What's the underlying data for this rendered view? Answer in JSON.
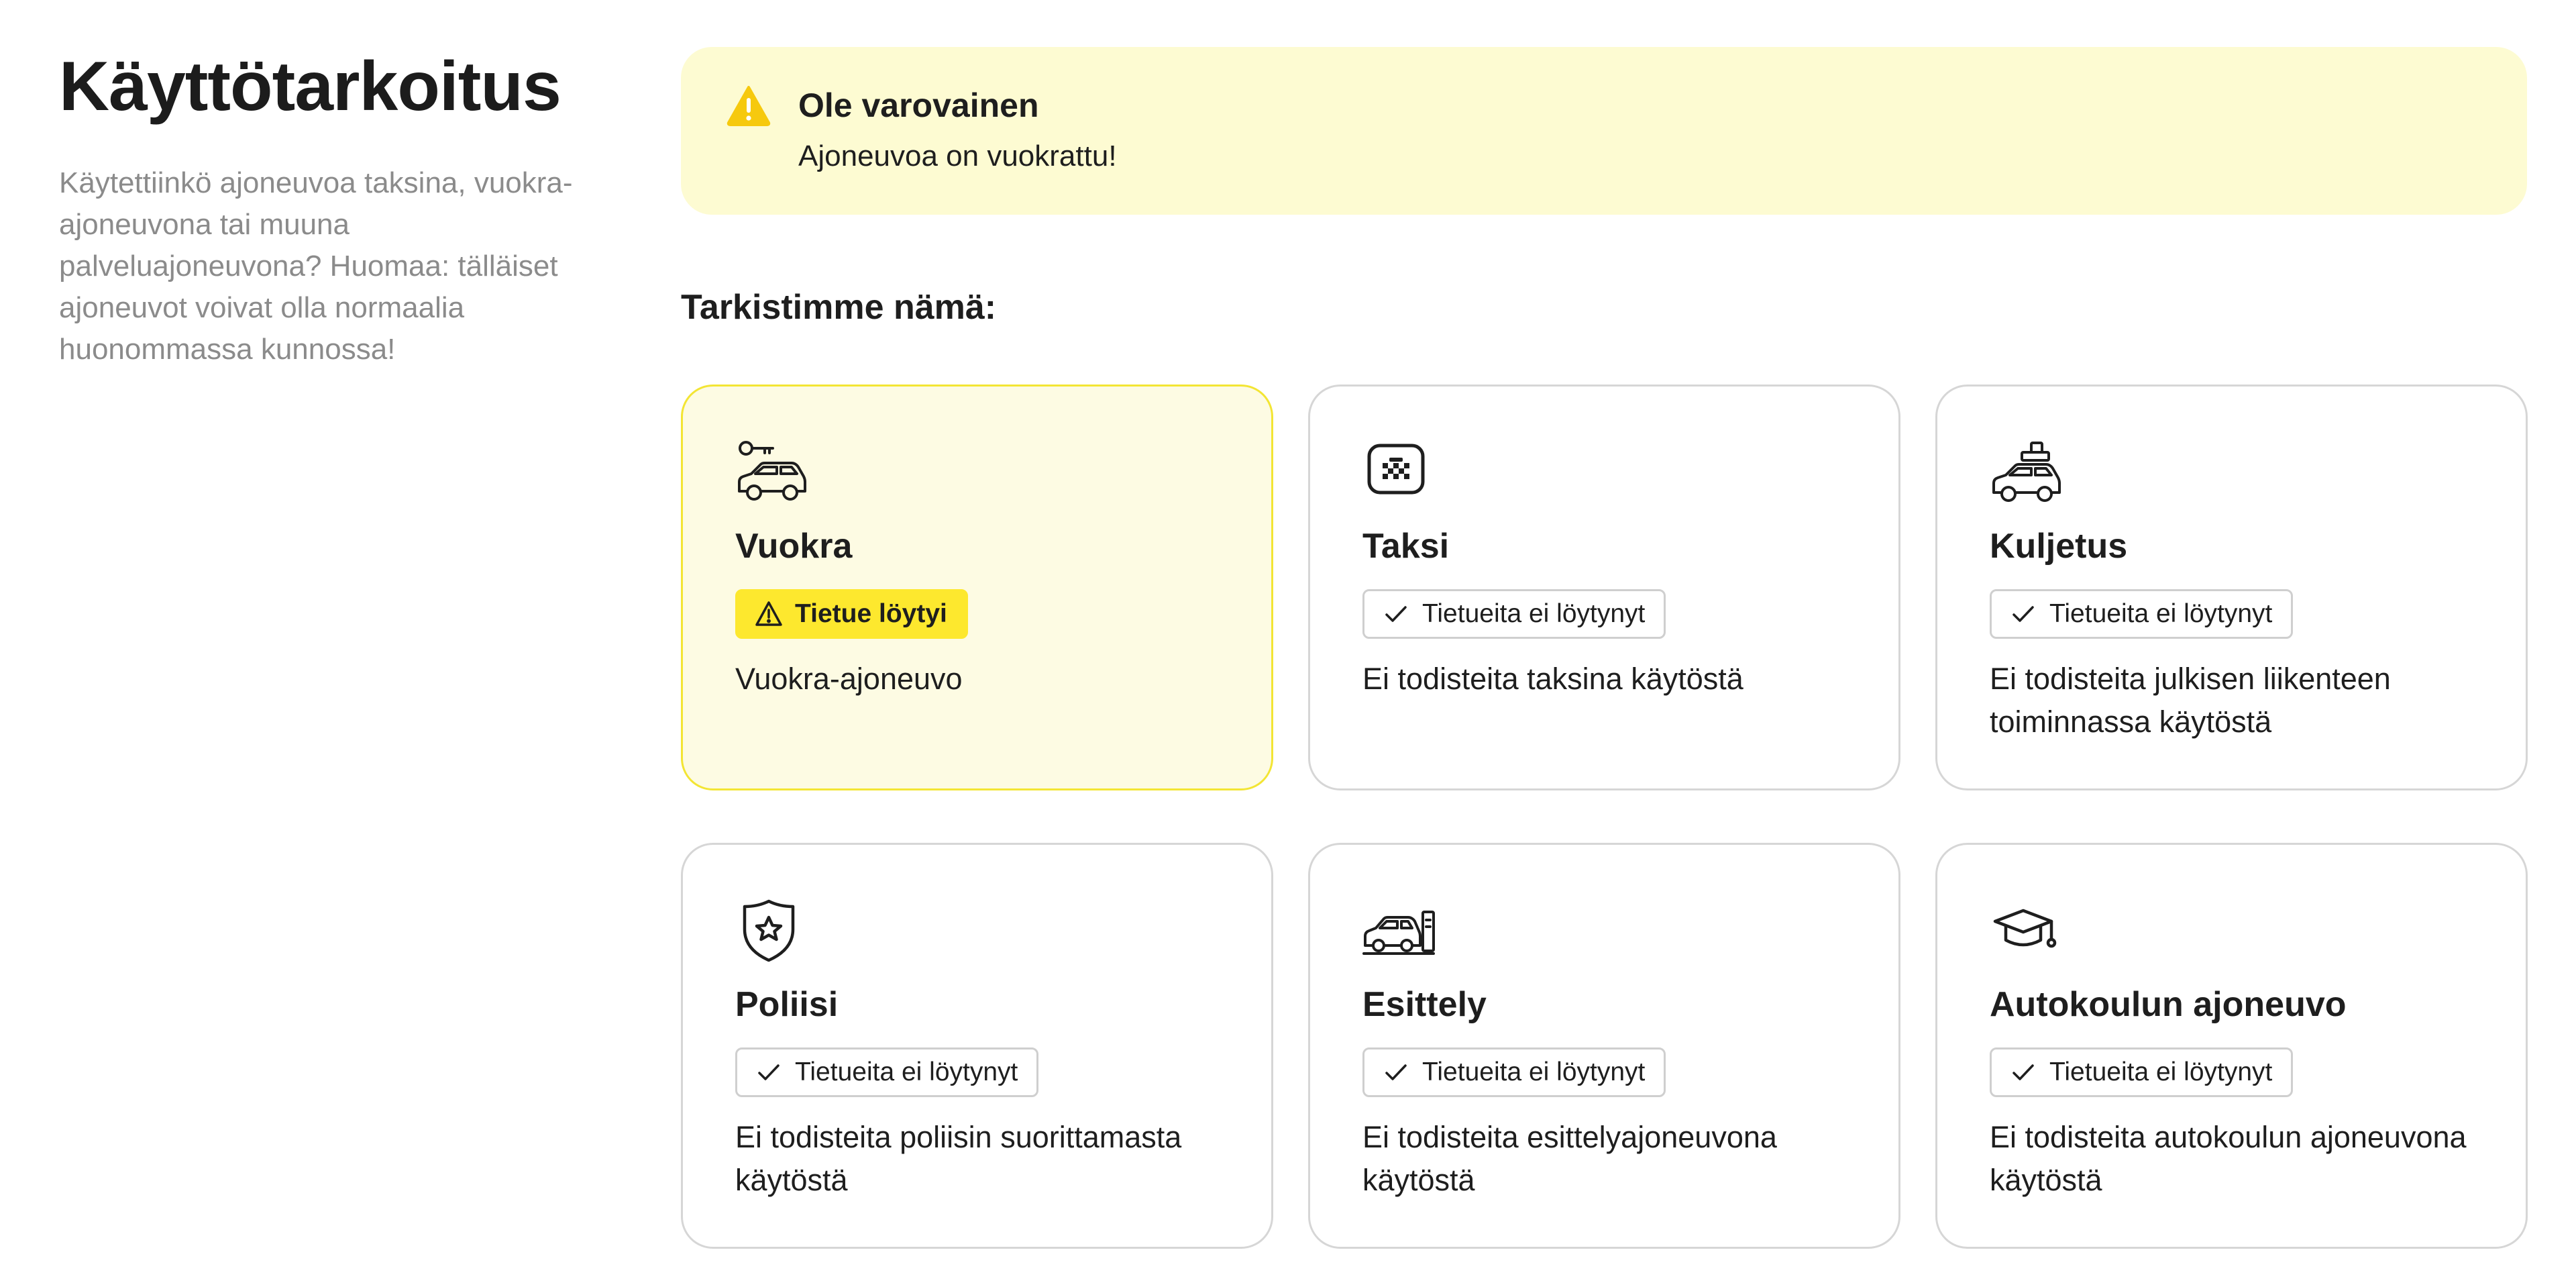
{
  "intro": {
    "title": "Käyttötarkoitus",
    "description": "Käytettiinkö ajoneuvoa taksina, vuokra-ajoneuvona tai muuna palveluajoneuvona? Huomaa: tälläiset ajoneuvot voivat olla normaalia huonommassa kunnossa!"
  },
  "banner": {
    "icon": "warning-triangle-icon",
    "title": "Ole varovainen",
    "text": "Ajoneuvoa on vuokrattu!",
    "background": "#fdfbd2"
  },
  "section_title": "Tarkistimme nämä:",
  "colors": {
    "accent_yellow": "#fde82e",
    "card_border": "#d6d6d6",
    "alert_border": "#f3e534"
  },
  "cards": [
    {
      "title": "Vuokra",
      "icon": "rental-car-key-icon",
      "status": "Tietue löytyi",
      "status_type": "found",
      "description": "Vuokra-ajoneuvo"
    },
    {
      "title": "Taksi",
      "icon": "taxi-sign-icon",
      "status": "Tietueita ei löytynyt",
      "status_type": "none",
      "description": "Ei todisteita taksina käytöstä"
    },
    {
      "title": "Kuljetus",
      "icon": "transport-car-icon",
      "status": "Tietueita ei löytynyt",
      "status_type": "none",
      "description": "Ei todisteita julkisen liikenteen toiminnassa käytöstä"
    },
    {
      "title": "Poliisi",
      "icon": "police-badge-icon",
      "status": "Tietueita ei löytynyt",
      "status_type": "none",
      "description": "Ei todisteita poliisin suorittamasta käytöstä"
    },
    {
      "title": "Esittely",
      "icon": "demo-car-icon",
      "status": "Tietueita ei löytynyt",
      "status_type": "none",
      "description": "Ei todisteita esittelyajoneuvona käytöstä"
    },
    {
      "title": "Autokoulun ajoneuvo",
      "icon": "graduation-cap-icon",
      "status": "Tietueita ei löytynyt",
      "status_type": "none",
      "description": "Ei todisteita autokoulun ajoneuvona käytöstä"
    }
  ]
}
